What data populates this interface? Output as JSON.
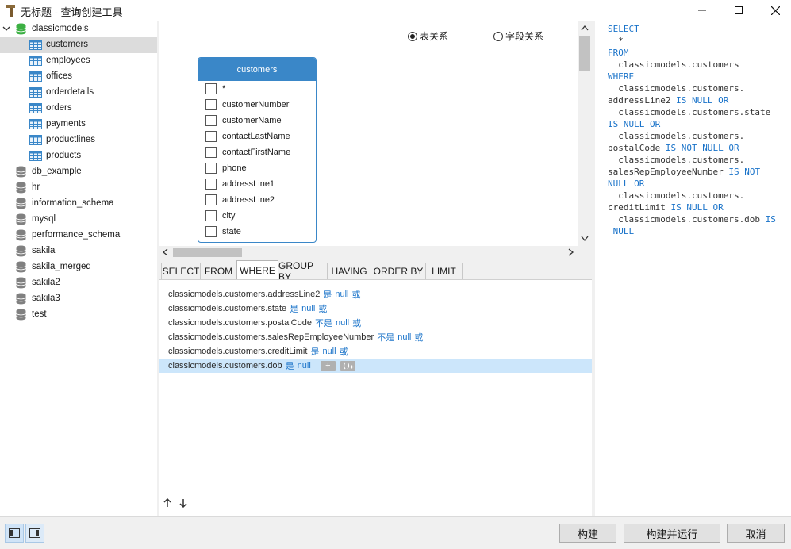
{
  "window": {
    "title": "无标题 - 查询创建工具"
  },
  "tree": {
    "root": {
      "label": "classicmodels",
      "expanded": true
    },
    "tables": [
      {
        "label": "customers",
        "selected": true
      },
      {
        "label": "employees"
      },
      {
        "label": "offices"
      },
      {
        "label": "orderdetails"
      },
      {
        "label": "orders"
      },
      {
        "label": "payments"
      },
      {
        "label": "productlines"
      },
      {
        "label": "products"
      }
    ],
    "databases": [
      {
        "label": "db_example"
      },
      {
        "label": "hr"
      },
      {
        "label": "information_schema"
      },
      {
        "label": "mysql"
      },
      {
        "label": "performance_schema"
      },
      {
        "label": "sakila"
      },
      {
        "label": "sakila_merged"
      },
      {
        "label": "sakila2"
      },
      {
        "label": "sakila3"
      },
      {
        "label": "test"
      }
    ]
  },
  "diagram": {
    "radio_table_relation": "表关系",
    "radio_field_relation": "字段关系",
    "selected_radio": "table_relation",
    "table": {
      "name": "customers",
      "fields": [
        "*",
        "customerNumber",
        "customerName",
        "contactLastName",
        "contactFirstName",
        "phone",
        "addressLine1",
        "addressLine2",
        "city",
        "state"
      ]
    }
  },
  "tabs": [
    {
      "label": "SELECT"
    },
    {
      "label": "FROM"
    },
    {
      "label": "WHERE",
      "active": true
    },
    {
      "label": "GROUP BY"
    },
    {
      "label": "HAVING"
    },
    {
      "label": "ORDER BY"
    },
    {
      "label": "LIMIT"
    }
  ],
  "conditions": [
    {
      "field": "classicmodels.customers.addressLine2",
      "op": "是",
      "value": "null",
      "join": "或"
    },
    {
      "field": "classicmodels.customers.state",
      "op": "是",
      "value": "null",
      "join": "或"
    },
    {
      "field": "classicmodels.customers.postalCode",
      "op": "不是",
      "value": "null",
      "join": "或"
    },
    {
      "field": "classicmodels.customers.salesRepEmployeeNumber",
      "op": "不是",
      "value": "null",
      "join": "或"
    },
    {
      "field": "classicmodels.customers.creditLimit",
      "op": "是",
      "value": "null",
      "join": "或"
    },
    {
      "field": "classicmodels.customers.dob",
      "op": "是",
      "value": "null",
      "join": "",
      "selected": true
    }
  ],
  "condition_buttons": {
    "add": "+",
    "add_group": "()+"
  },
  "sql_lines": [
    [
      {
        "t": "SELECT",
        "k": true
      }
    ],
    [
      {
        "t": "  *",
        "k": false
      }
    ],
    [
      {
        "t": "FROM",
        "k": true
      }
    ],
    [
      {
        "t": "  classicmodels.customers",
        "k": false
      }
    ],
    [
      {
        "t": "WHERE",
        "k": true
      }
    ],
    [
      {
        "t": "  classicmodels.customers.",
        "k": false
      }
    ],
    [
      {
        "t": "addressLine2 ",
        "k": false
      },
      {
        "t": "IS NULL OR",
        "k": true
      }
    ],
    [
      {
        "t": "  classicmodels.customers.state",
        "k": false
      }
    ],
    [
      {
        "t": "IS NULL OR",
        "k": true
      }
    ],
    [
      {
        "t": "  classicmodels.customers.",
        "k": false
      }
    ],
    [
      {
        "t": "postalCode ",
        "k": false
      },
      {
        "t": "IS NOT NULL OR",
        "k": true
      }
    ],
    [
      {
        "t": "  classicmodels.customers.",
        "k": false
      }
    ],
    [
      {
        "t": "salesRepEmployeeNumber ",
        "k": false
      },
      {
        "t": "IS NOT",
        "k": true
      }
    ],
    [
      {
        "t": "NULL OR",
        "k": true
      }
    ],
    [
      {
        "t": "  classicmodels.customers.",
        "k": false
      }
    ],
    [
      {
        "t": "creditLimit ",
        "k": false
      },
      {
        "t": "IS NULL OR",
        "k": true
      }
    ],
    [
      {
        "t": "  classicmodels.customers.dob ",
        "k": false
      },
      {
        "t": "IS",
        "k": true
      }
    ],
    [
      {
        "t": " NULL",
        "k": true
      }
    ]
  ],
  "buttons": {
    "build": "构建",
    "build_run": "构建并运行",
    "cancel": "取消"
  },
  "colors": {
    "accent": "#3a87c8",
    "keyword": "#1a73c9",
    "selection": "#cce6fb",
    "db_active": "#3cb043",
    "db_inactive": "#808080"
  }
}
